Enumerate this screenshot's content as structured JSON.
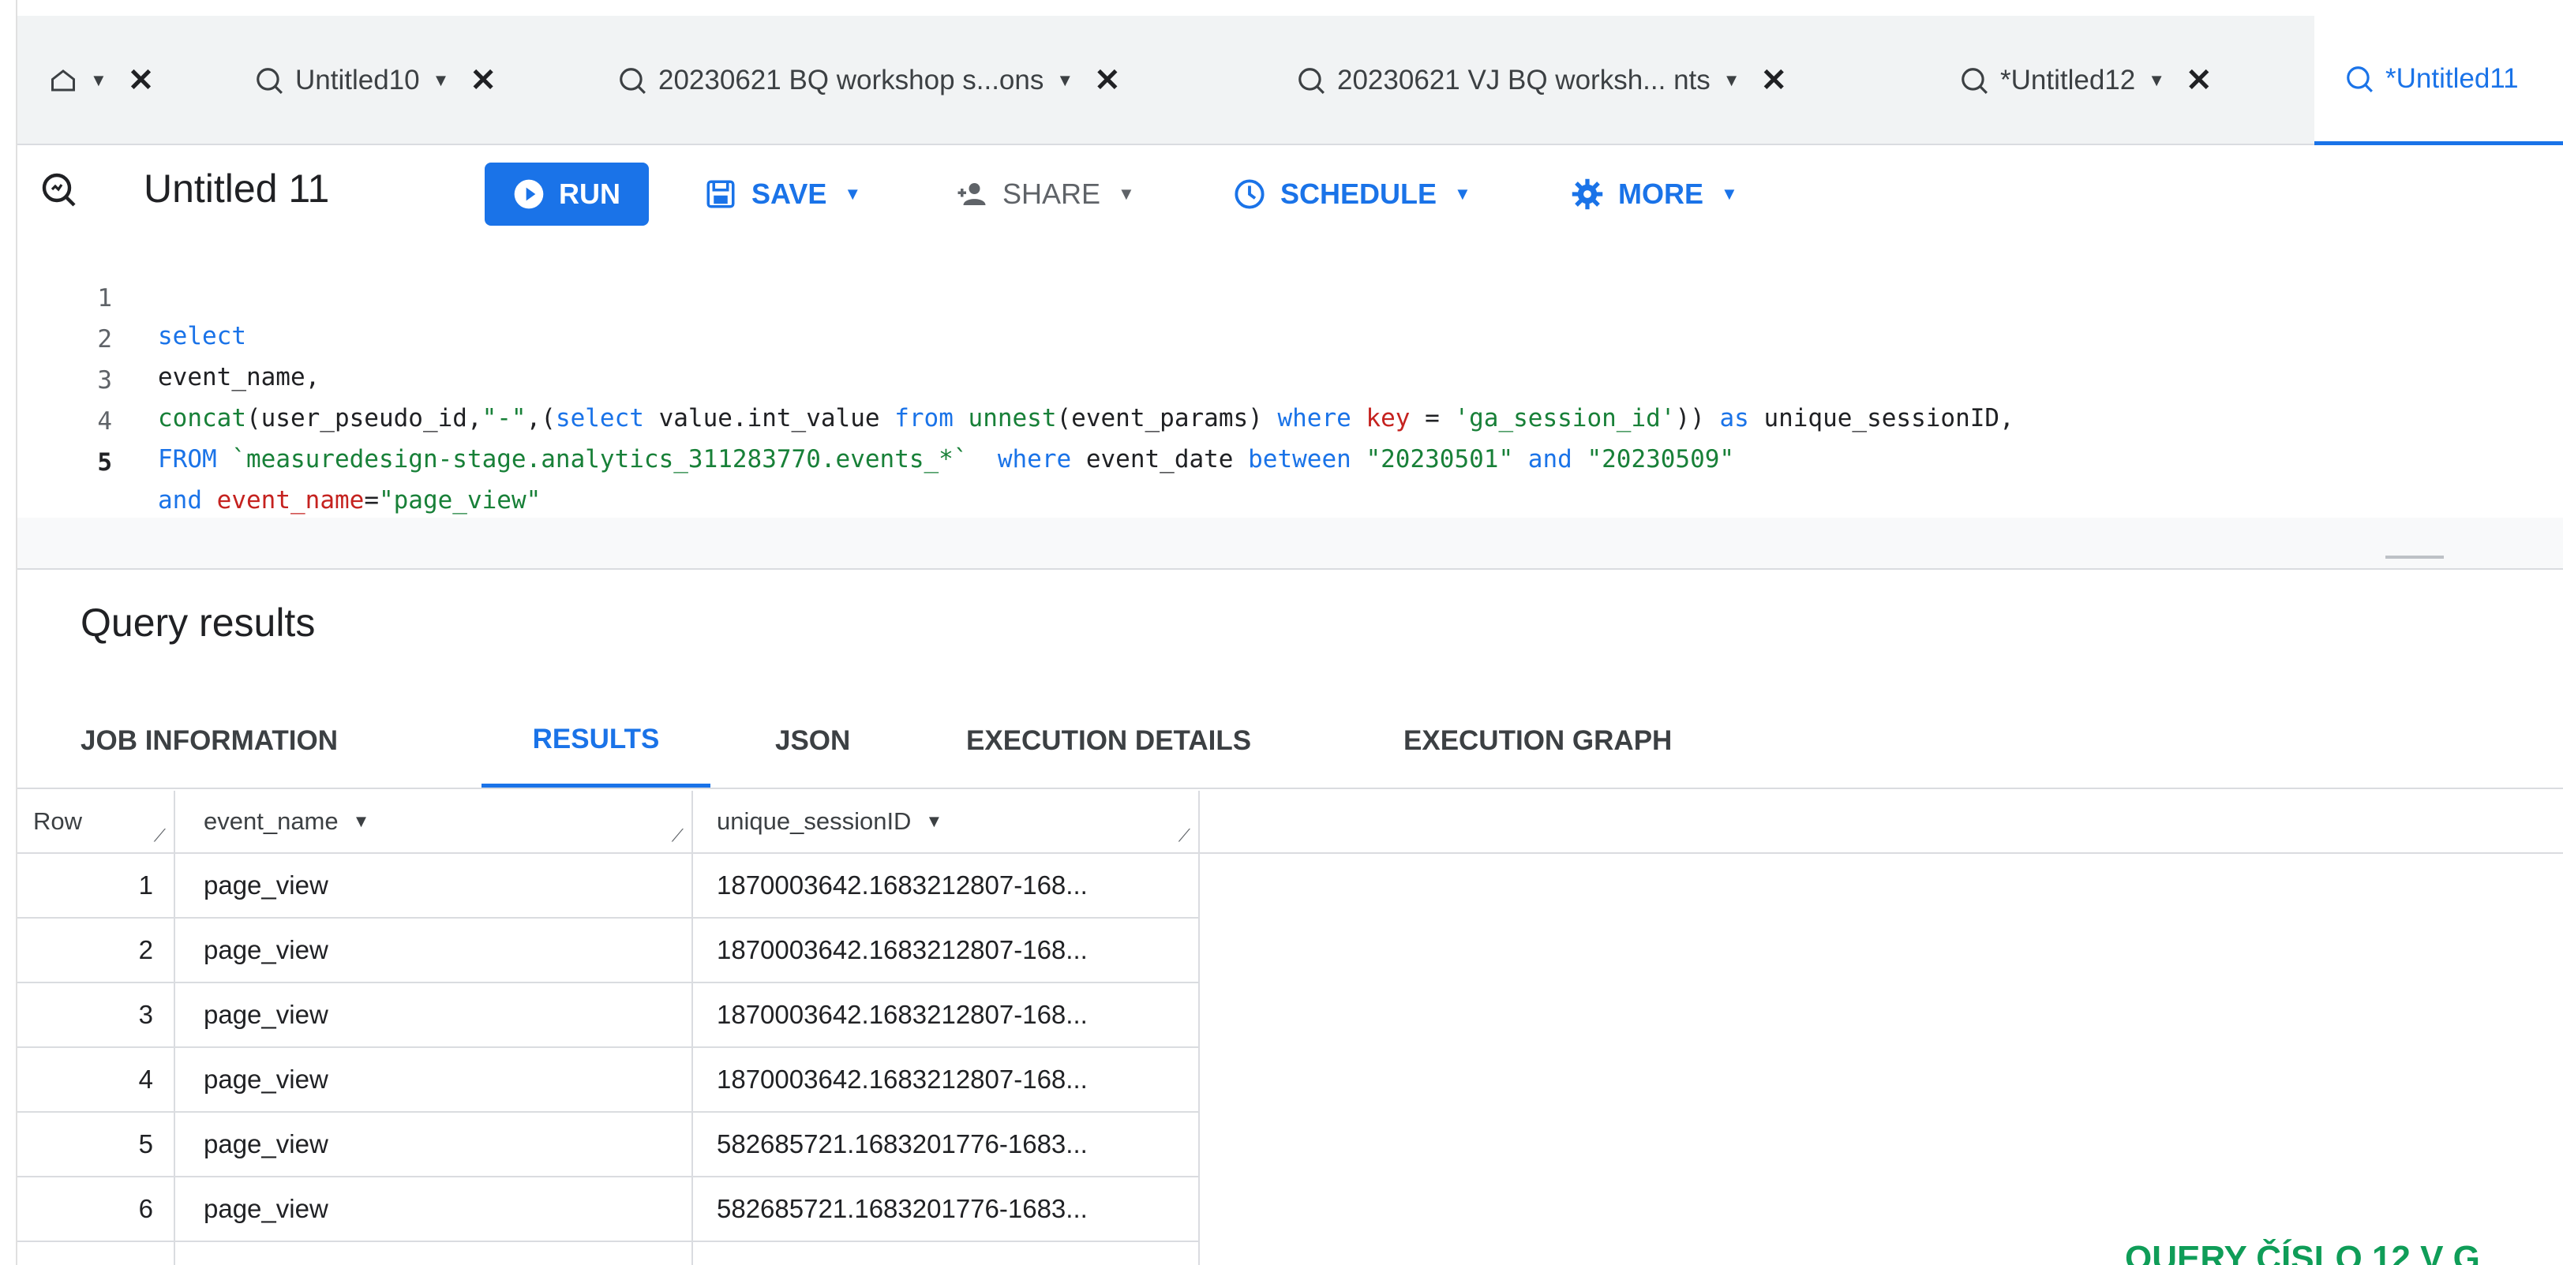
{
  "tabs": [
    {
      "label": "Untitled10",
      "active": false
    },
    {
      "label": "20230621 BQ workshop s...ons",
      "active": false
    },
    {
      "label": "20230621 VJ BQ worksh... nts",
      "active": false
    },
    {
      "label": "*Untitled12",
      "active": false
    },
    {
      "label": "*Untitled11",
      "active": true
    }
  ],
  "toolbar": {
    "title": "Untitled 11",
    "run_label": "RUN",
    "save_label": "SAVE",
    "share_label": "SHARE",
    "schedule_label": "SCHEDULE",
    "more_label": "MORE"
  },
  "editor": {
    "line_numbers": [
      "1",
      "2",
      "3",
      "4",
      "5"
    ],
    "line1": "select",
    "line2": "event_name,",
    "line3": {
      "p1": "concat",
      "p2": "(user_pseudo_id,",
      "p3": "\"-\"",
      "p4": ",(",
      "p5": "select",
      "p6": " value.int_value ",
      "p7": "from",
      "p8": " ",
      "p9": "unnest",
      "p10": "(event_params) ",
      "p11": "where",
      "p12": " ",
      "p13": "key",
      "p14": " = ",
      "p15": "'ga_session_id'",
      "p16": ")) ",
      "p17": "as",
      "p18": " unique_sessionID,"
    },
    "line4": {
      "p1": "FROM",
      "p2": " ",
      "p3": "`measuredesign-stage.analytics_311283770.events_*`",
      "p4": "  ",
      "p5": "where",
      "p6": " event_date ",
      "p7": "between",
      "p8": " ",
      "p9": "\"20230501\"",
      "p10": " ",
      "p11": "and",
      "p12": " ",
      "p13": "\"20230509\""
    },
    "line5": {
      "p1": "and",
      "p2": " ",
      "p3": "event_name",
      "p4": "=",
      "p5": "\"page_view\""
    }
  },
  "results": {
    "title": "Query results",
    "subtabs": [
      "JOB INFORMATION",
      "RESULTS",
      "JSON",
      "EXECUTION DETAILS",
      "EXECUTION GRAPH"
    ],
    "active_subtab": "RESULTS",
    "columns": [
      "Row",
      "event_name",
      "unique_sessionID"
    ],
    "rows": [
      {
        "row": "1",
        "event_name": "page_view",
        "session": "1870003642.1683212807-168..."
      },
      {
        "row": "2",
        "event_name": "page_view",
        "session": "1870003642.1683212807-168..."
      },
      {
        "row": "3",
        "event_name": "page_view",
        "session": "1870003642.1683212807-168..."
      },
      {
        "row": "4",
        "event_name": "page_view",
        "session": "1870003642.1683212807-168..."
      },
      {
        "row": "5",
        "event_name": "page_view",
        "session": "582685721.1683201776-1683..."
      },
      {
        "row": "6",
        "event_name": "page_view",
        "session": "582685721.1683201776-1683..."
      }
    ]
  },
  "overlay": "QUERY ČÍSLO 12 V G",
  "colors": {
    "accent": "#1a73e8",
    "string": "#188038",
    "keyword_red": "#c5221f"
  }
}
